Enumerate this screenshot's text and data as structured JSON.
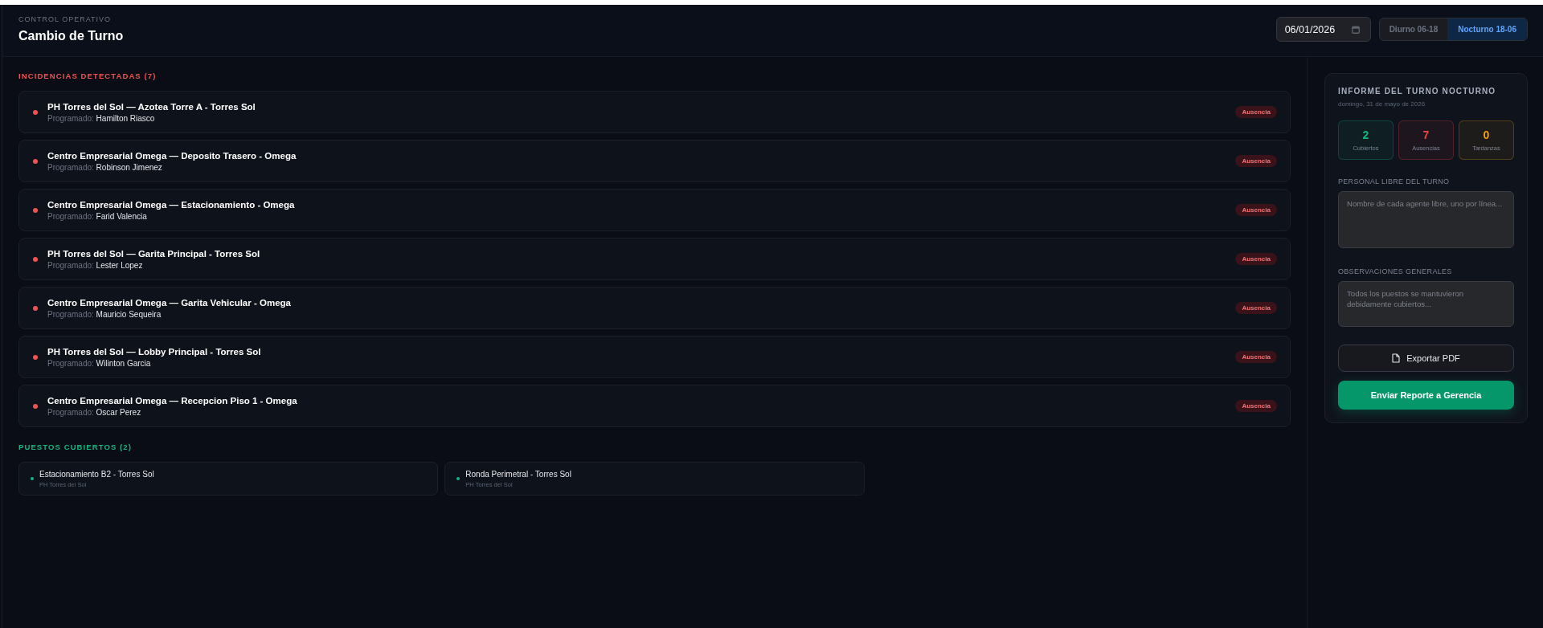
{
  "header": {
    "eyebrow": "CONTROL OPERATIVO",
    "title": "Cambio de Turno",
    "date": "06/01/2026",
    "shifts": [
      {
        "label": "Diurno 06-18",
        "selected": false
      },
      {
        "label": "Nocturno 18-06",
        "selected": true
      }
    ]
  },
  "sections": [
    {
      "kind": "incidents",
      "title": "INCIDENCIAS DETECTADAS (7)",
      "items": [
        {
          "title": "PH Torres del Sol — Azotea Torre A - Torres Sol",
          "scheduled_label": "Programado:",
          "scheduled": "Hamilton Riasco",
          "badge": "Ausencia"
        },
        {
          "title": "Centro Empresarial Omega — Deposito Trasero - Omega",
          "scheduled_label": "Programado:",
          "scheduled": "Robinson Jimenez",
          "badge": "Ausencia"
        },
        {
          "title": "Centro Empresarial Omega — Estacionamiento - Omega",
          "scheduled_label": "Programado:",
          "scheduled": "Farid Valencia",
          "badge": "Ausencia"
        },
        {
          "title": "PH Torres del Sol — Garita Principal - Torres Sol",
          "scheduled_label": "Programado:",
          "scheduled": "Lester Lopez",
          "badge": "Ausencia"
        },
        {
          "title": "Centro Empresarial Omega — Garita Vehicular - Omega",
          "scheduled_label": "Programado:",
          "scheduled": "Mauricio Sequeira",
          "badge": "Ausencia"
        },
        {
          "title": "PH Torres del Sol — Lobby Principal - Torres Sol",
          "scheduled_label": "Programado:",
          "scheduled": "Wilinton Garcia",
          "badge": "Ausencia"
        },
        {
          "title": "Centro Empresarial Omega — Recepcion Piso 1 - Omega",
          "scheduled_label": "Programado:",
          "scheduled": "Oscar Perez",
          "badge": "Ausencia"
        }
      ]
    },
    {
      "kind": "covered",
      "title": "PUESTOS CUBIERTOS (2)",
      "items": [
        {
          "title": "Estacionamiento B2 - Torres Sol",
          "site": "PH Torres del Sol"
        },
        {
          "title": "Ronda Perimetral - Torres Sol",
          "site": "PH Torres del Sol"
        }
      ]
    }
  ],
  "report": {
    "title": "INFORME DEL TURNO NOCTURNO",
    "date": "domingo, 31 de mayo de 2026",
    "stats": [
      {
        "value": "2",
        "label": "Cubiertos",
        "color": "#10b981"
      },
      {
        "value": "7",
        "label": "Ausencias",
        "color": "#ef4444"
      },
      {
        "value": "0",
        "label": "Tardanzas",
        "color": "#f59e0b"
      }
    ],
    "fields": [
      {
        "label": "PERSONAL LIBRE DEL TURNO",
        "placeholder": "Nombre de cada agente libre, uno por línea..."
      },
      {
        "label": "OBSERVACIONES GENERALES",
        "placeholder": "Todos los puestos se mantuvieron debidamente cubiertos..."
      }
    ],
    "buttons": [
      {
        "kind": "export",
        "label": "Exportar PDF"
      },
      {
        "kind": "send",
        "label": "Enviar Reporte a Gerencia"
      }
    ]
  }
}
